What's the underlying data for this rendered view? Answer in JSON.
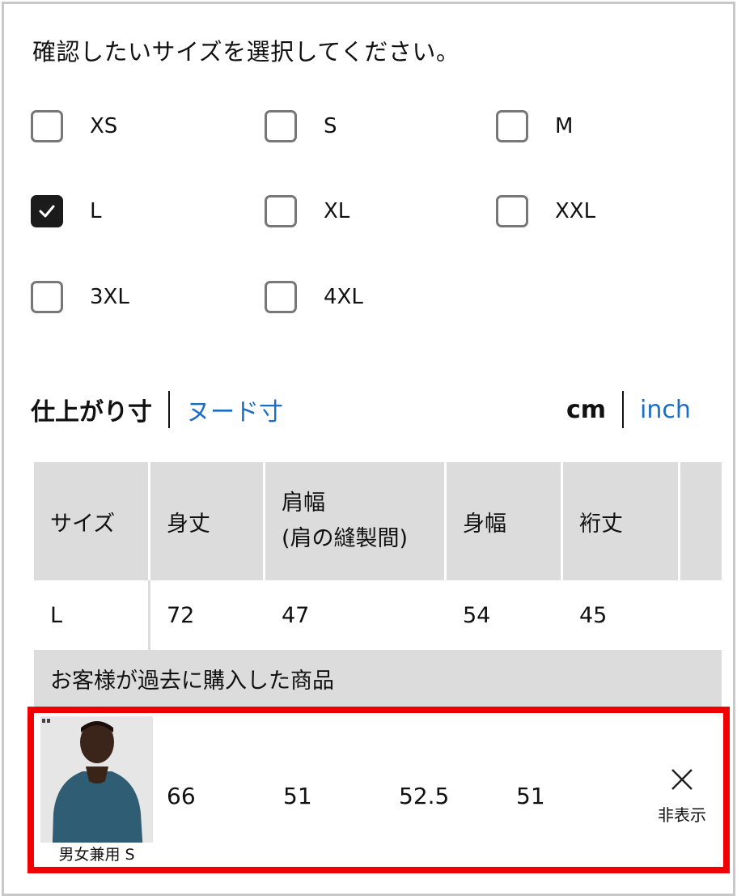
{
  "prompt": "確認したいサイズを選択してください。",
  "sizes": [
    {
      "label": "XS",
      "checked": false
    },
    {
      "label": "S",
      "checked": false
    },
    {
      "label": "M",
      "checked": false
    },
    {
      "label": "L",
      "checked": true
    },
    {
      "label": "XL",
      "checked": false
    },
    {
      "label": "XXL",
      "checked": false
    },
    {
      "label": "3XL",
      "checked": false
    },
    {
      "label": "4XL",
      "checked": false
    }
  ],
  "measure_toggle": {
    "finished": "仕上がり寸",
    "nude": "ヌード寸"
  },
  "unit_toggle": {
    "cm": "cm",
    "inch": "inch"
  },
  "table": {
    "headers": [
      "サイズ",
      "身丈",
      "肩幅",
      "(肩の縫製間)",
      "身幅",
      "裄丈"
    ],
    "row": [
      "L",
      "72",
      "47",
      "54",
      "45"
    ]
  },
  "purchased": {
    "heading": "お客様が過去に購入した商品",
    "caption": "男女兼用 S",
    "values": [
      "66",
      "51",
      "52.5",
      "51"
    ],
    "hide_label": "非表示"
  },
  "colors": {
    "accent_link": "#1c6dc4",
    "highlight_border": "#f00000",
    "header_bg": "#dcdcdc"
  }
}
